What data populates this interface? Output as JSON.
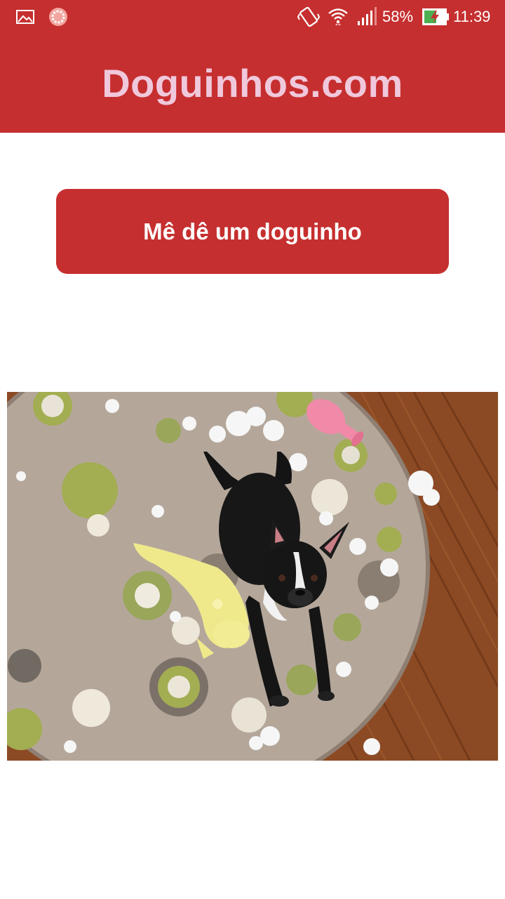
{
  "status_bar": {
    "battery": "58%",
    "time": "11:39",
    "icons": [
      "image-notification-icon",
      "loading-app-icon",
      "vibrate-icon",
      "wifi-icon",
      "signal-icon",
      "battery-charging-icon"
    ]
  },
  "app_bar": {
    "title": "Doguinhos.com",
    "title_color": "#f0c8dc",
    "background": "#c62f2f"
  },
  "main": {
    "button_label": "Mê dê um doguinho",
    "image_subject": "black and white dog lying on a round rug among torn toy stuffing"
  },
  "colors": {
    "accent": "#c62f2f",
    "surface": "#ffffff"
  }
}
